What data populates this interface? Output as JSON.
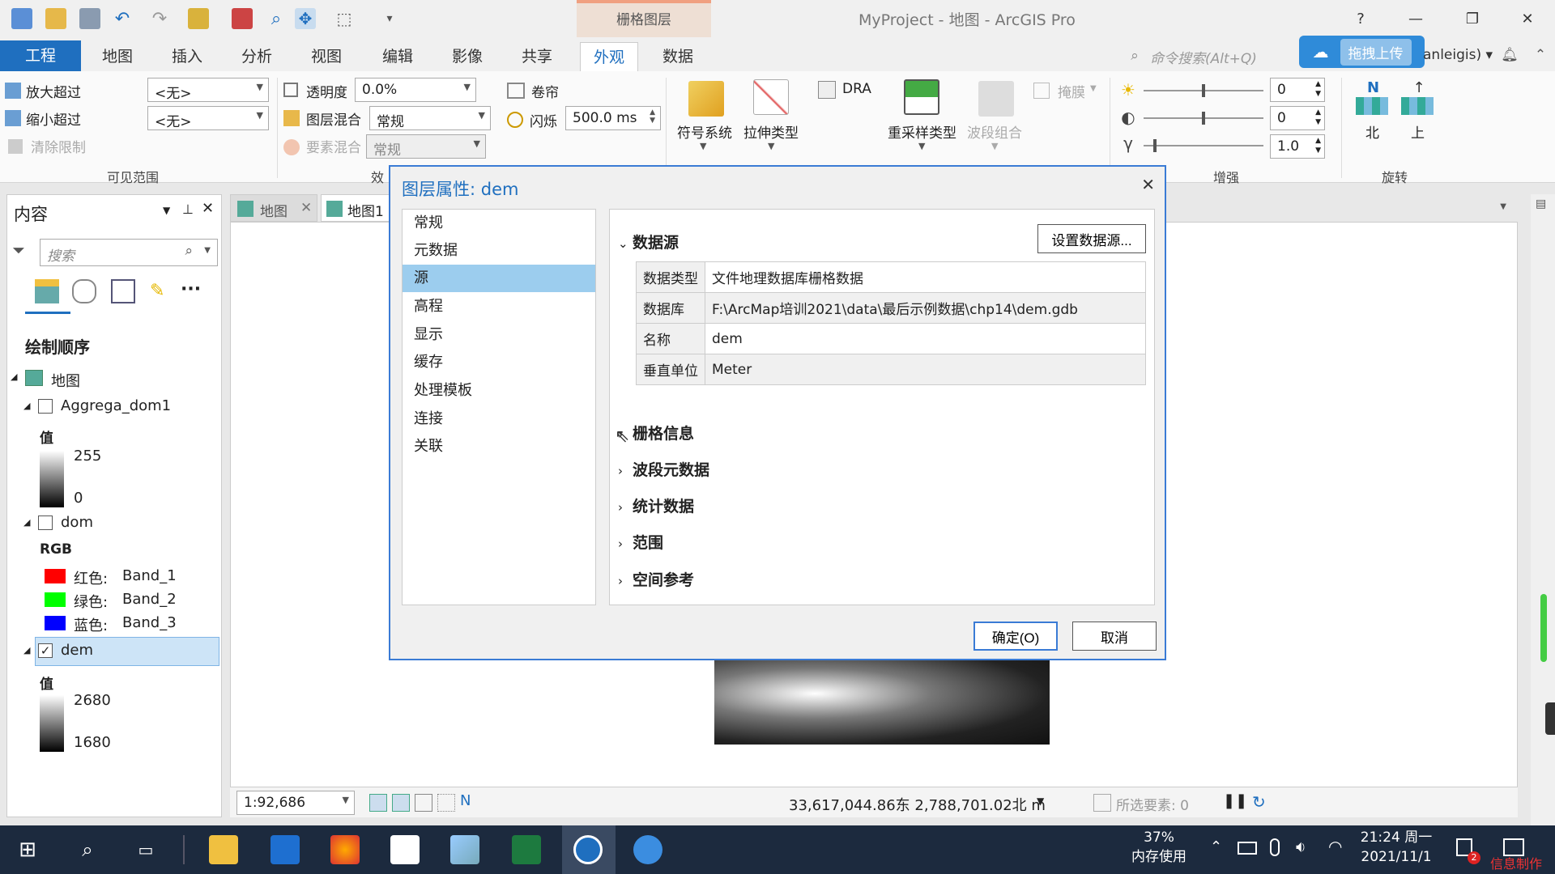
{
  "window": {
    "title": "MyProject - 地图 - ArcGIS Pro",
    "context_tab": "栅格图层",
    "help": "?",
    "minimize": "—",
    "restore": "❐",
    "close": "✕"
  },
  "tabs": [
    "工程",
    "地图",
    "插入",
    "分析",
    "视图",
    "编辑",
    "影像",
    "共享",
    "外观",
    "数据"
  ],
  "selected_tab": "外观",
  "command_search": {
    "placeholder": "命令搜索(Alt+Q)"
  },
  "upload_button": "拖拽上传",
  "user": "anleigis) ▾",
  "ribbon": {
    "visible_range": {
      "zoom_in_beyond": "放大超过",
      "zoom_out_beyond": "缩小超过",
      "clear_limits": "清除限制",
      "zoom_in_value": "<无>",
      "zoom_out_value": "<无>",
      "group_label": "可见范围"
    },
    "effects": {
      "transparency": "透明度",
      "transparency_value": "0.0%",
      "layer_blend": "图层混合",
      "layer_blend_value": "常规",
      "feature_blend": "要素混合",
      "feature_blend_value": "常规",
      "swipe": "卷帘",
      "flicker": "闪烁",
      "flicker_value": "500.0  ms",
      "group_label": "效"
    },
    "rendering": {
      "symbology": "符号系统",
      "stretch_type": "拉伸类型",
      "dra": "DRA",
      "resample_type": "重采样类型",
      "band_combination": "波段组合",
      "mask": "掩膜"
    },
    "enhance": {
      "brightness": "0",
      "contrast": "0",
      "gamma": "1.0",
      "gamma_symbol": "γ",
      "group_label": "增强"
    },
    "rotate": {
      "north": "北",
      "north_letter": "N",
      "up": "上",
      "group_label": "旋转"
    }
  },
  "contents": {
    "title": "内容",
    "search_placeholder": "搜索",
    "drawing_order": "绘制顺序",
    "map": "地图",
    "layers": [
      {
        "name": "Aggrega_dom1",
        "checked": false,
        "legend_title": "值",
        "high": "255",
        "low": "0"
      },
      {
        "name": "dom",
        "checked": false,
        "legend_title": "RGB",
        "bands": [
          {
            "label": "红色:",
            "band": "Band_1",
            "color": "#ff0000"
          },
          {
            "label": "绿色:",
            "band": "Band_2",
            "color": "#00ff00"
          },
          {
            "label": "蓝色:",
            "band": "Band_3",
            "color": "#0000ff"
          }
        ]
      },
      {
        "name": "dem",
        "checked": true,
        "legend_title": "值",
        "high": "2680",
        "low": "1680"
      }
    ]
  },
  "map_tabs": [
    "地图",
    "地图1"
  ],
  "statusbar": {
    "scale": "1:92,686",
    "coords": "33,617,044.86东 2,788,701.02北 m",
    "selected_features": "所选要素: 0"
  },
  "dialog": {
    "title": "图层属性: dem",
    "nav": [
      "常规",
      "元数据",
      "源",
      "高程",
      "显示",
      "缓存",
      "处理模板",
      "连接",
      "关联"
    ],
    "selected_nav": "源",
    "data_source_section": "数据源",
    "set_data_source": "设置数据源...",
    "properties": [
      {
        "key": "数据类型",
        "value": "文件地理数据库栅格数据"
      },
      {
        "key": "数据库",
        "value": "F:\\ArcMap培训2021\\data\\最后示例数据\\chp14\\dem.gdb"
      },
      {
        "key": "名称",
        "value": "dem"
      },
      {
        "key": "垂直单位",
        "value": "Meter"
      }
    ],
    "collapsed_sections": [
      "栅格信息",
      "波段元数据",
      "统计数据",
      "范围",
      "空间参考"
    ],
    "ok": "确定(O)",
    "cancel": "取消"
  },
  "taskbar": {
    "memory_percent": "37%",
    "memory_label": "内存使用",
    "time": "21:24 周一",
    "date": "2021/11/1",
    "notification_count": "2",
    "watermark": "信息制作"
  }
}
